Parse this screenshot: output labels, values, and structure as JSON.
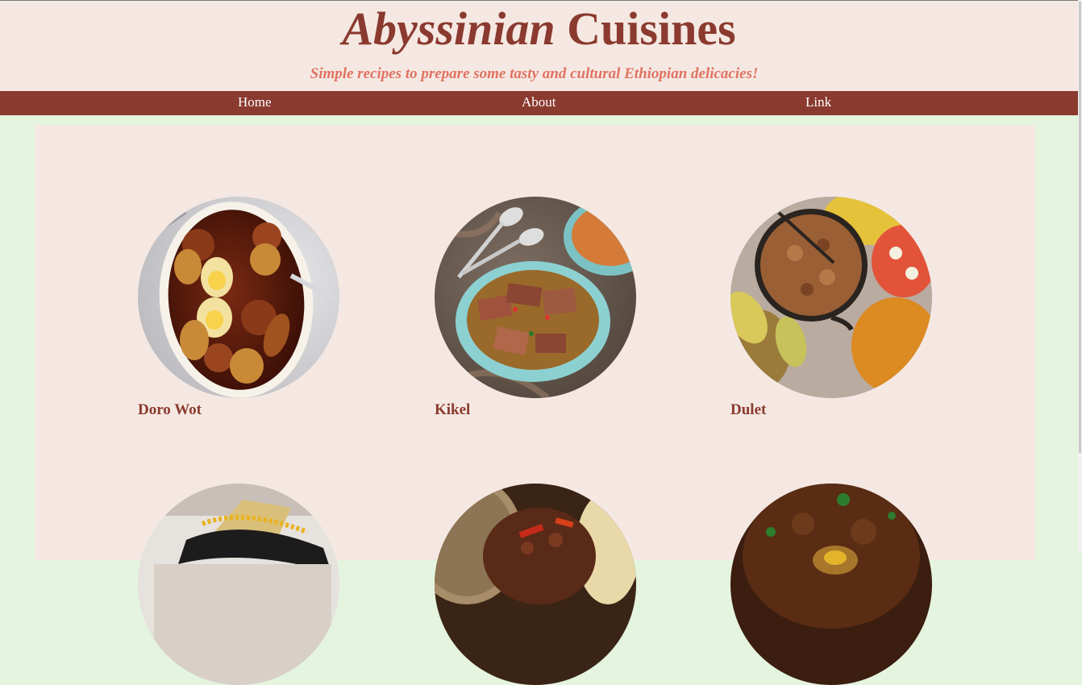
{
  "header": {
    "title_italic": "Abyssinian",
    "title_regular": "Cuisines",
    "subtitle": "Simple recipes to prepare some tasty and cultural Ethiopian delicacies!"
  },
  "nav": {
    "items": [
      {
        "label": "Home"
      },
      {
        "label": "About"
      },
      {
        "label": "Link"
      }
    ]
  },
  "dishes": [
    {
      "name": "Doro Wot"
    },
    {
      "name": "Kikel"
    },
    {
      "name": "Dulet"
    },
    {
      "name": ""
    },
    {
      "name": ""
    },
    {
      "name": ""
    }
  ],
  "colors": {
    "brand": "#8b3a2f",
    "subtitle": "#e07262",
    "panel": "#f5e8e2",
    "page_bg": "#e4f4df"
  }
}
